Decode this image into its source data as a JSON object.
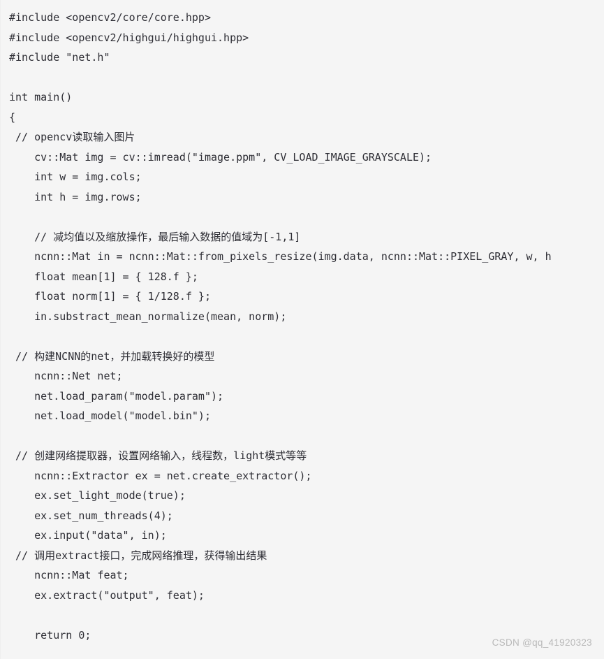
{
  "page": {
    "kind": "code-snippet-screenshot",
    "language": "C++",
    "background_color": "#f5f5f5",
    "text_color": "#2e2e35",
    "watermark_color": "#b9b9b9"
  },
  "code": {
    "lines": [
      "#include <opencv2/core/core.hpp>",
      "#include <opencv2/highgui/highgui.hpp>",
      "#include \"net.h\"",
      "",
      "int main()",
      "{",
      " // opencv读取输入图片",
      "    cv::Mat img = cv::imread(\"image.ppm\", CV_LOAD_IMAGE_GRAYSCALE);",
      "    int w = img.cols;",
      "    int h = img.rows;",
      "",
      "    // 减均值以及缩放操作，最后输入数据的值域为[-1,1]",
      "    ncnn::Mat in = ncnn::Mat::from_pixels_resize(img.data, ncnn::Mat::PIXEL_GRAY, w, h",
      "    float mean[1] = { 128.f };",
      "    float norm[1] = { 1/128.f };",
      "    in.substract_mean_normalize(mean, norm);",
      "",
      " // 构建NCNN的net，并加载转换好的模型",
      "    ncnn::Net net;",
      "    net.load_param(\"model.param\");",
      "    net.load_model(\"model.bin\");",
      "",
      " // 创建网络提取器，设置网络输入，线程数，light模式等等",
      "    ncnn::Extractor ex = net.create_extractor();",
      "    ex.set_light_mode(true);",
      "    ex.set_num_threads(4);",
      "    ex.input(\"data\", in);",
      " // 调用extract接口，完成网络推理，获得输出结果",
      "    ncnn::Mat feat;",
      "    ex.extract(\"output\", feat);",
      "",
      "    return 0;"
    ]
  },
  "watermark": {
    "text": "CSDN @qq_41920323"
  }
}
